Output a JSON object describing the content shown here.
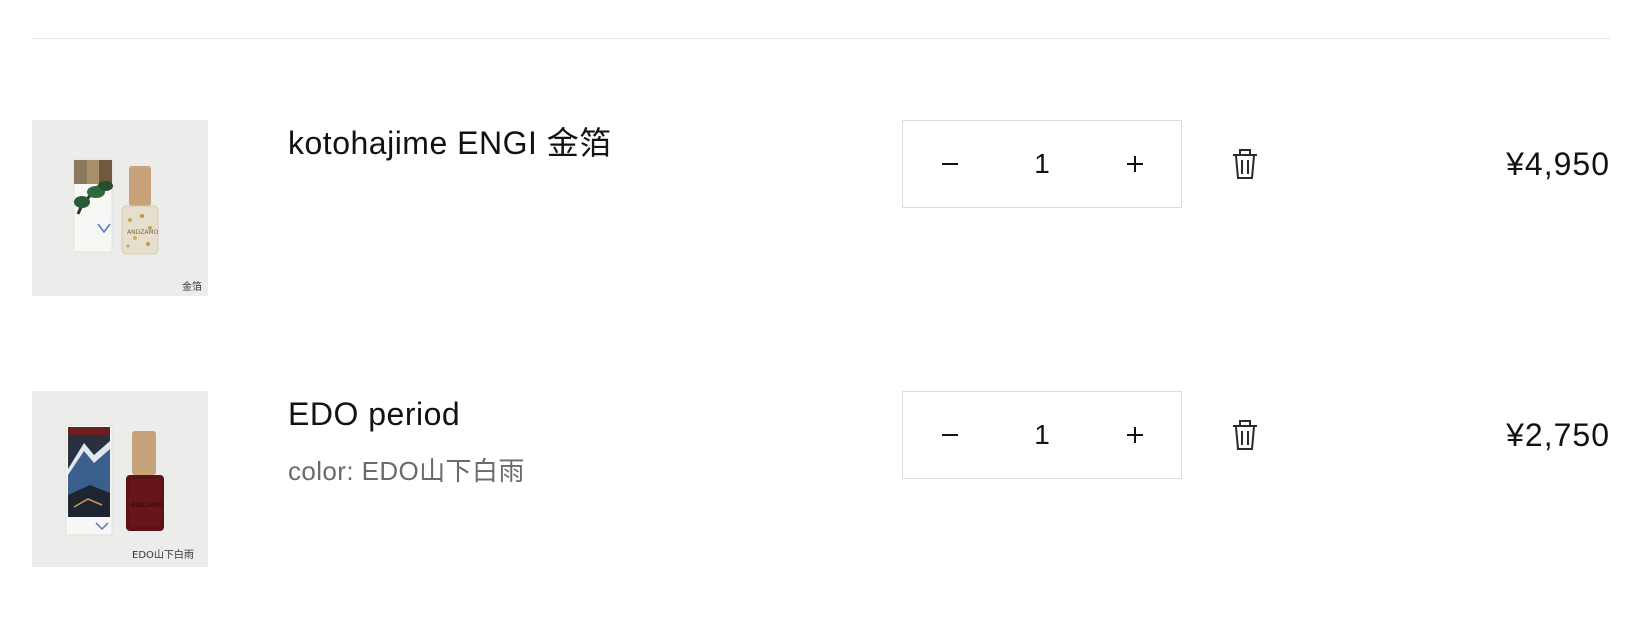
{
  "cart": {
    "items": [
      {
        "name": "kotohajime ENGI 金箔",
        "option": "",
        "quantity": "1",
        "price": "¥4,950",
        "thumbnail_label": "金箔",
        "decrease_label": "−",
        "increase_label": "+"
      },
      {
        "name": "EDO period",
        "option": "color: EDO山下白雨",
        "quantity": "1",
        "price": "¥2,750",
        "thumbnail_label": "EDO山下白雨",
        "decrease_label": "−",
        "increase_label": "+"
      }
    ]
  },
  "colors": {
    "text": "#121212",
    "muted_text": "#6b6b6b",
    "border": "#dcdcdc",
    "divider": "#e6e6e6",
    "thumbnail_bg": "#ececea"
  },
  "icons": {
    "decrease": "minus-icon",
    "increase": "plus-icon",
    "remove": "trash-icon"
  }
}
